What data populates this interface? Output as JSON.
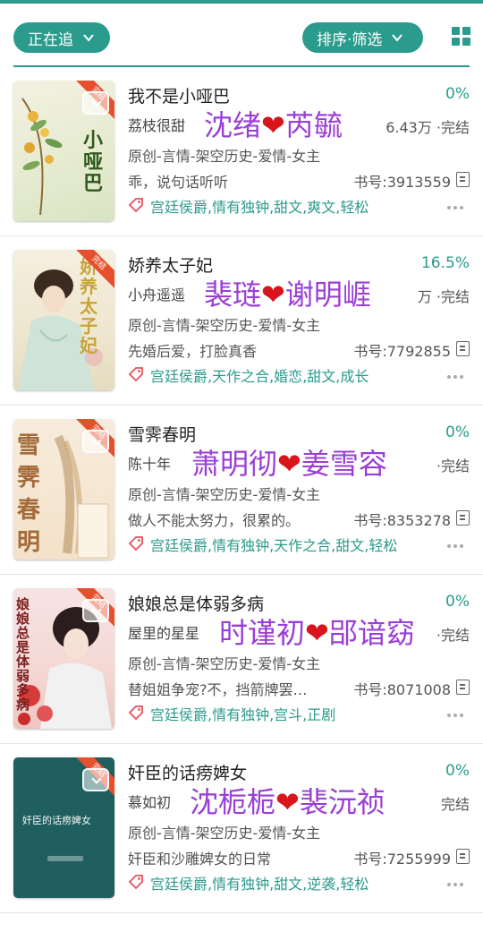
{
  "toolbar": {
    "filter_label": "正在追",
    "sort_label": "排序·筛选"
  },
  "colors": {
    "accent": "#2a9b8c",
    "tag_icon": "#e8505b",
    "overlay_text": "#9a3ed6",
    "heart": "#d8141c"
  },
  "books": [
    {
      "title": "我不是小哑巴",
      "progress": "0%",
      "author": "荔枝很甜",
      "stats": "6.43万 ·完结",
      "category": "原创-言情-架空历史-爱情-女主",
      "intro": "乖，说句话听听",
      "book_no": "书号:3913559",
      "tags": "宫廷侯爵,情有独钟,甜文,爽文,轻松",
      "overlay_left": "沈绪",
      "overlay_heart": "❤",
      "overlay_right": "芮毓",
      "cover_text": "小哑巴"
    },
    {
      "title": "娇养太子妃",
      "progress": "16.5%",
      "author": "小舟遥遥",
      "stats": "万 ·完结",
      "category": "原创-言情-架空历史-爱情-女主",
      "intro": "先婚后爱，打脸真香",
      "book_no": "书号:7792855",
      "tags": "宫廷侯爵,天作之合,婚恋,甜文,成长",
      "overlay_left": "裴琏",
      "overlay_heart": "❤",
      "overlay_right": "谢明崕",
      "cover_text": "娇养太子妃"
    },
    {
      "title": "雪霁春明",
      "progress": "0%",
      "author": "陈十年",
      "stats": "·完结",
      "category": "原创-言情-架空历史-爱情-女主",
      "intro": "做人不能太努力，很累的。",
      "book_no": "书号:8353278",
      "tags": "宫廷侯爵,情有独钟,天作之合,甜文,轻松",
      "overlay_left": "萧明彻",
      "overlay_heart": "❤",
      "overlay_right": "姜雪容",
      "cover_text": "雪霁春明"
    },
    {
      "title": "娘娘总是体弱多病",
      "progress": "0%",
      "author": "屋里的星星",
      "stats": "·完结",
      "category": "原创-言情-架空历史-爱情-女主",
      "intro": "替姐姐争宠?不，挡箭牌罢…",
      "book_no": "书号:8071008",
      "tags": "宫廷侯爵,情有独钟,宫斗,正剧",
      "overlay_left": "时谨初",
      "overlay_heart": "❤",
      "overlay_right": "郘谙窈",
      "cover_text": "娘娘总是体弱多病"
    },
    {
      "title": "奸臣的话痨婢女",
      "progress": "0%",
      "author": "慕如初",
      "stats": "完结",
      "category": "原创-言情-架空历史-爱情-女主",
      "intro": "奸臣和沙雕婢女的日常",
      "book_no": "书号:7255999",
      "tags": "宫廷侯爵,情有独钟,甜文,逆袭,轻松",
      "overlay_left": "沈栀栀",
      "overlay_heart": "❤",
      "overlay_right": "裴沅祯",
      "cover_text": "奸臣的话痨婢女"
    }
  ]
}
